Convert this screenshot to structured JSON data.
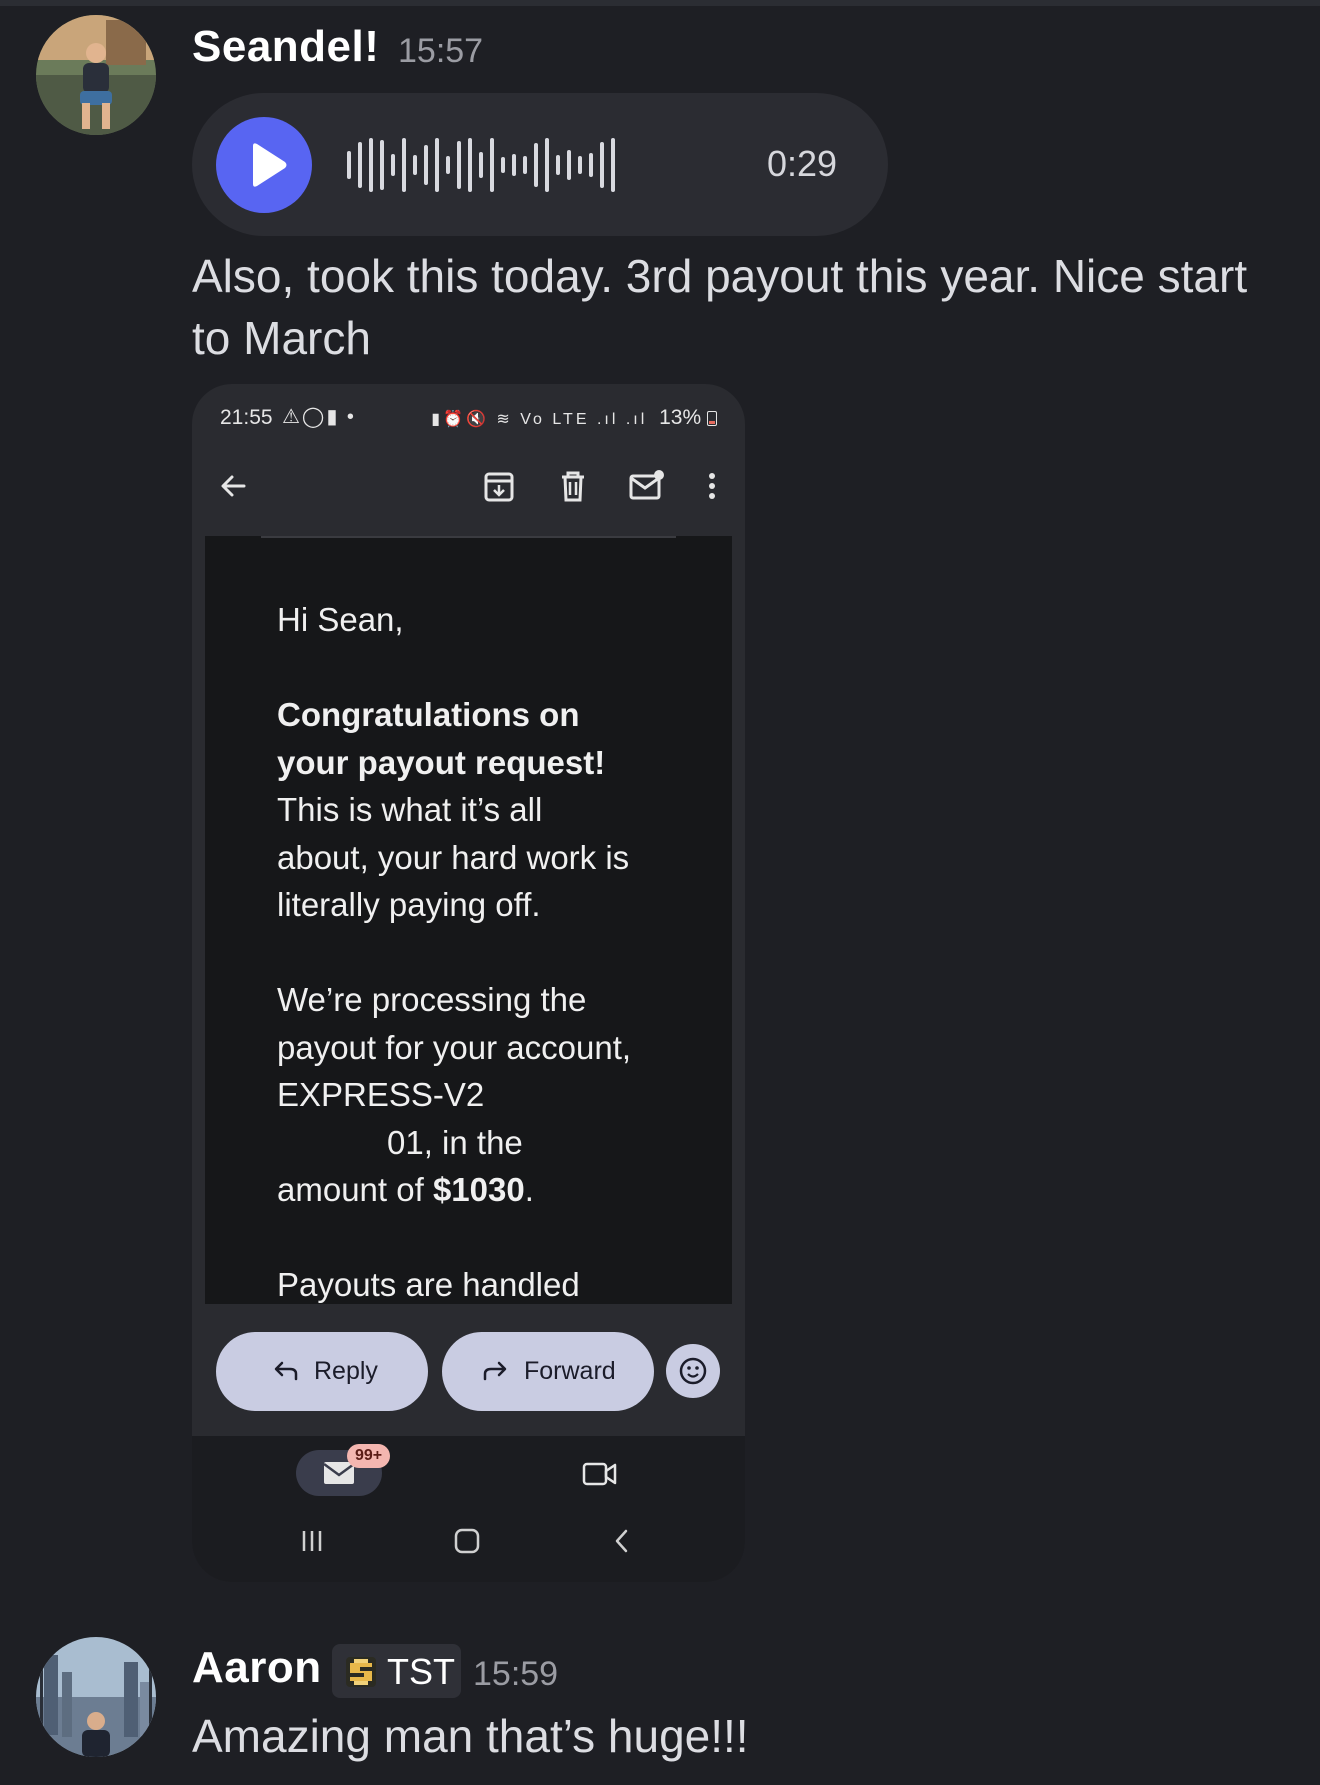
{
  "messages": [
    {
      "author": "Seandel!",
      "time": "15:57",
      "voice": {
        "duration": "0:29"
      },
      "text_line1": "Also, took this today. 3rd payout this year. Nice start",
      "text_line2": "to March",
      "attachment": {
        "status": {
          "time": "21:55",
          "left_icons": "⚠◯▮ •",
          "right_icons": "▮⏰🔇 ≋ Vo LTE .ıl .ıl",
          "battery": "13%"
        },
        "email": {
          "greeting": "Hi Sean,",
          "bold_line1": "Congratulations on",
          "bold_line2": "your payout request!",
          "line3": "This is what it’s all",
          "line4": "about, your hard work is",
          "line5": "literally paying off.",
          "line6": "We’re processing the",
          "line7": "payout for your account,",
          "line8": "EXPRESS-V2",
          "line9": "01, in the",
          "line10": "amount of ",
          "amount": "$1030",
          "period": ".",
          "line11": "Payouts are handled"
        },
        "actions": {
          "reply": "Reply",
          "forward": "Forward"
        },
        "badge": "99+"
      }
    },
    {
      "author": "Aaron",
      "role_tag": "TST",
      "time": "15:59",
      "text": "Amazing man that’s huge!!!"
    }
  ],
  "colors": {
    "background": "#1e1f24",
    "play_button": "#5865f2",
    "action_pill": "#c9cce2"
  }
}
